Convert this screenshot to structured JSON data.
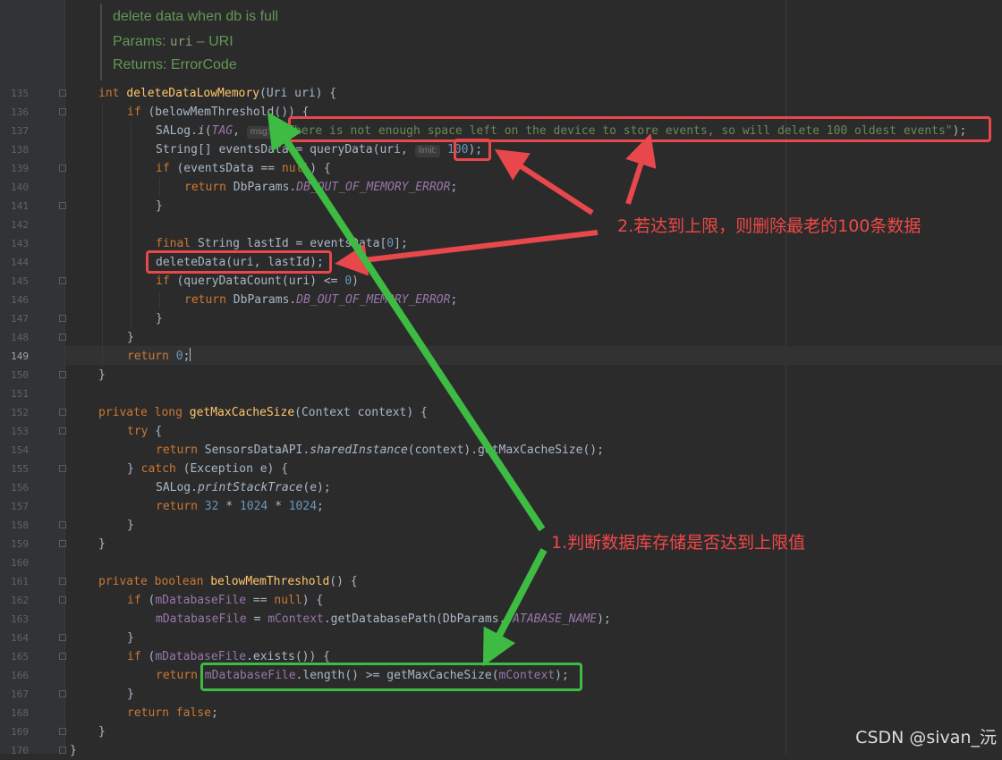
{
  "doc_comment": {
    "line1": "delete data when db is full",
    "params_label": "Params:",
    "params_name": "uri",
    "params_desc": "– URI",
    "returns_label": "Returns:",
    "returns_value": "ErrorCode"
  },
  "line_numbers": [
    "135",
    "136",
    "137",
    "138",
    "139",
    "140",
    "141",
    "142",
    "143",
    "144",
    "145",
    "146",
    "147",
    "148",
    "149",
    "150",
    "151",
    "152",
    "153",
    "154",
    "155",
    "156",
    "157",
    "158",
    "159",
    "160",
    "161",
    "162",
    "163",
    "164",
    "165",
    "166",
    "167",
    "168",
    "169",
    "170"
  ],
  "hints": {
    "msg": "msg:",
    "limit": "limit:"
  },
  "code": {
    "l135_kw": "int",
    "l135_fn": "deleteDataLowMemory",
    "l135_rest": "(Uri uri) {",
    "l136_kw": "if",
    "l136_rest": " (belowMemThreshold()) {",
    "l137_a": "SALog.",
    "l137_fn": "i",
    "l137_b": "(",
    "l137_tag": "TAG",
    "l137_c": ", ",
    "l137_str": "\"There is not enough space left on the device to store events, so will delete 100 oldest events\"",
    "l137_d": ");",
    "l138_a": "String[] eventsData = queryData(uri, ",
    "l138_num": "100",
    "l138_b": ");",
    "l139_kw": "if",
    "l139_a": " (eventsData == ",
    "l139_kw2": "null",
    "l139_b": ") {",
    "l140_kw": "return",
    "l140_a": " DbParams.",
    "l140_const": "DB_OUT_OF_MEMORY_ERROR",
    "l140_b": ";",
    "l141": "}",
    "l143_kw": "final",
    "l143_a": " String lastId = eventsData[",
    "l143_num": "0",
    "l143_b": "];",
    "l144": "deleteData(uri, lastId);",
    "l145_kw": "if",
    "l145_a": " (queryDataCount(uri) <= ",
    "l145_num": "0",
    "l145_b": ")",
    "l146_kw": "return",
    "l146_a": " DbParams.",
    "l146_const": "DB_OUT_OF_MEMORY_ERROR",
    "l146_b": ";",
    "l147": "}",
    "l148": "}",
    "l149_kw": "return",
    "l149_num": " 0",
    "l149_b": ";",
    "l150": "}",
    "l152_kw": "private long",
    "l152_fn": "getMaxCacheSize",
    "l152_rest": "(Context context) {",
    "l153_kw": "try",
    "l153_rest": " {",
    "l154_kw": "return",
    "l154_a": " SensorsDataAPI.",
    "l154_it": "sharedInstance",
    "l154_b": "(context).getMaxCacheSize();",
    "l155_a": "} ",
    "l155_kw": "catch",
    "l155_b": " (Exception e) {",
    "l156_a": "SALog.",
    "l156_it": "printStackTrace",
    "l156_b": "(e);",
    "l157_kw": "return",
    "l157_n1": " 32",
    "l157_a": " * ",
    "l157_n2": "1024",
    "l157_b": " * ",
    "l157_n3": "1024",
    "l157_c": ";",
    "l158": "}",
    "l159": "}",
    "l161_kw": "private boolean",
    "l161_fn": "belowMemThreshold",
    "l161_rest": "() {",
    "l162_kw": "if",
    "l162_a": " (",
    "l162_fld": "mDatabaseFile",
    "l162_b": " == ",
    "l162_kw2": "null",
    "l162_c": ") {",
    "l163_fld": "mDatabaseFile",
    "l163_a": " = ",
    "l163_fld2": "mContext",
    "l163_b": ".getDatabasePath(DbParams.",
    "l163_const": "DATABASE_NAME",
    "l163_c": ");",
    "l164": "}",
    "l165_kw": "if",
    "l165_a": " (",
    "l165_fld": "mDatabaseFile",
    "l165_b": ".exists()) {",
    "l166_kw": "return",
    "l166_fld": "mDatabaseFile",
    "l166_a": ".length() >= getMaxCacheSize(",
    "l166_fld2": "mContext",
    "l166_b": ");",
    "l167": "}",
    "l168_kw": "return",
    "l168_kw2": " false",
    "l168_b": ";",
    "l169": "}",
    "l170": "}"
  },
  "annotations": {
    "step1": "1.判断数据库存储是否达到上限值",
    "step2": "2.若达到上限，则删除最老的100条数据"
  },
  "watermark": "CSDN @sivan_沅",
  "colors": {
    "annotation_red": "#e8474c",
    "annotation_green": "#3dbb43",
    "editor_bg": "#2b2b2b"
  }
}
